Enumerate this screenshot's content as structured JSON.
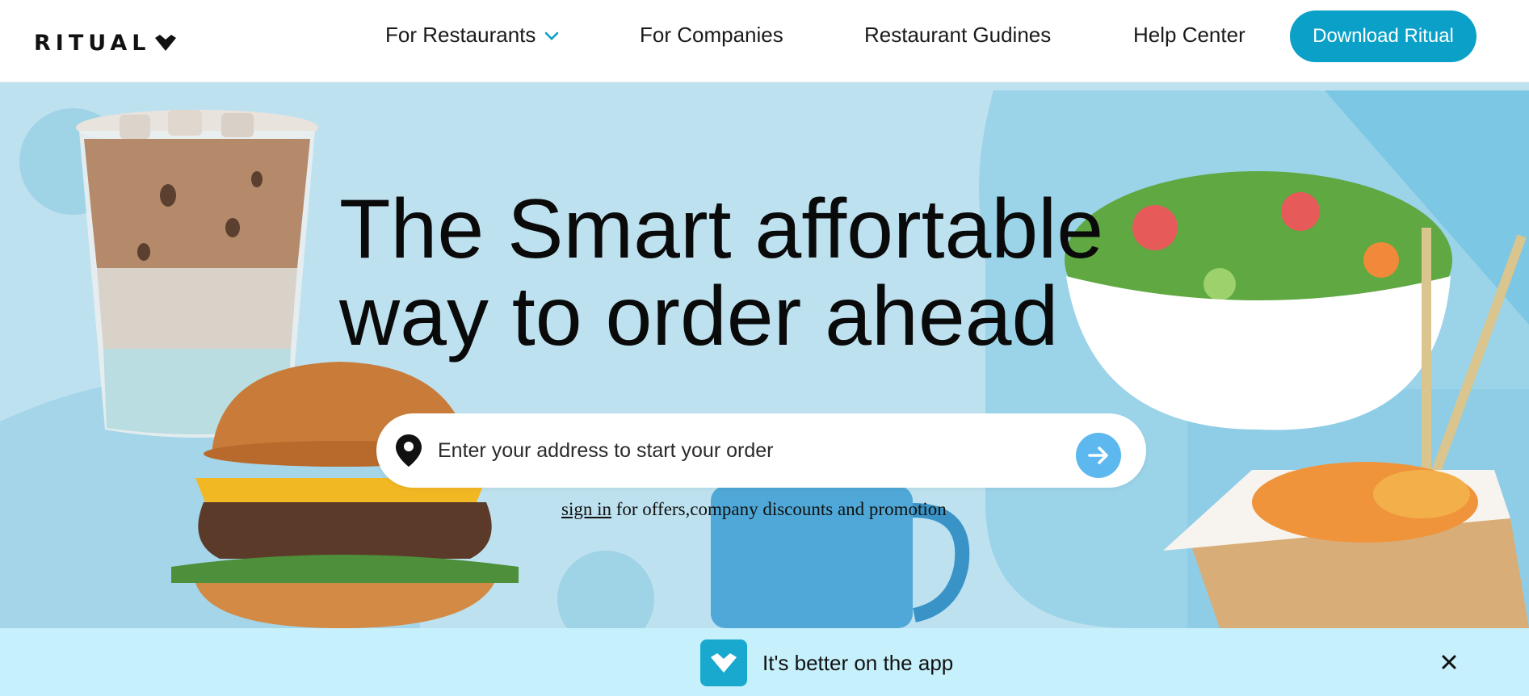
{
  "brand": {
    "name": "RITUAL",
    "accent": "#0aa0c8"
  },
  "nav": {
    "items": [
      {
        "label": "For Restaurants",
        "has_dropdown": true
      },
      {
        "label": "For Companies"
      },
      {
        "label": "Restaurant Gudines"
      },
      {
        "label": "Help Center"
      }
    ],
    "download_label": "Download Ritual"
  },
  "hero": {
    "headline_line1": "The Smart affortable",
    "headline_line2": "way to order ahead",
    "search": {
      "placeholder": "Enter your address to start your order",
      "value": ""
    },
    "signin_link": "sign in",
    "signin_rest": " for offers,company discounts and promotion",
    "background": "#bde1ef"
  },
  "app_banner": {
    "text": "It's better on the app",
    "background": "#c6f0fb"
  }
}
